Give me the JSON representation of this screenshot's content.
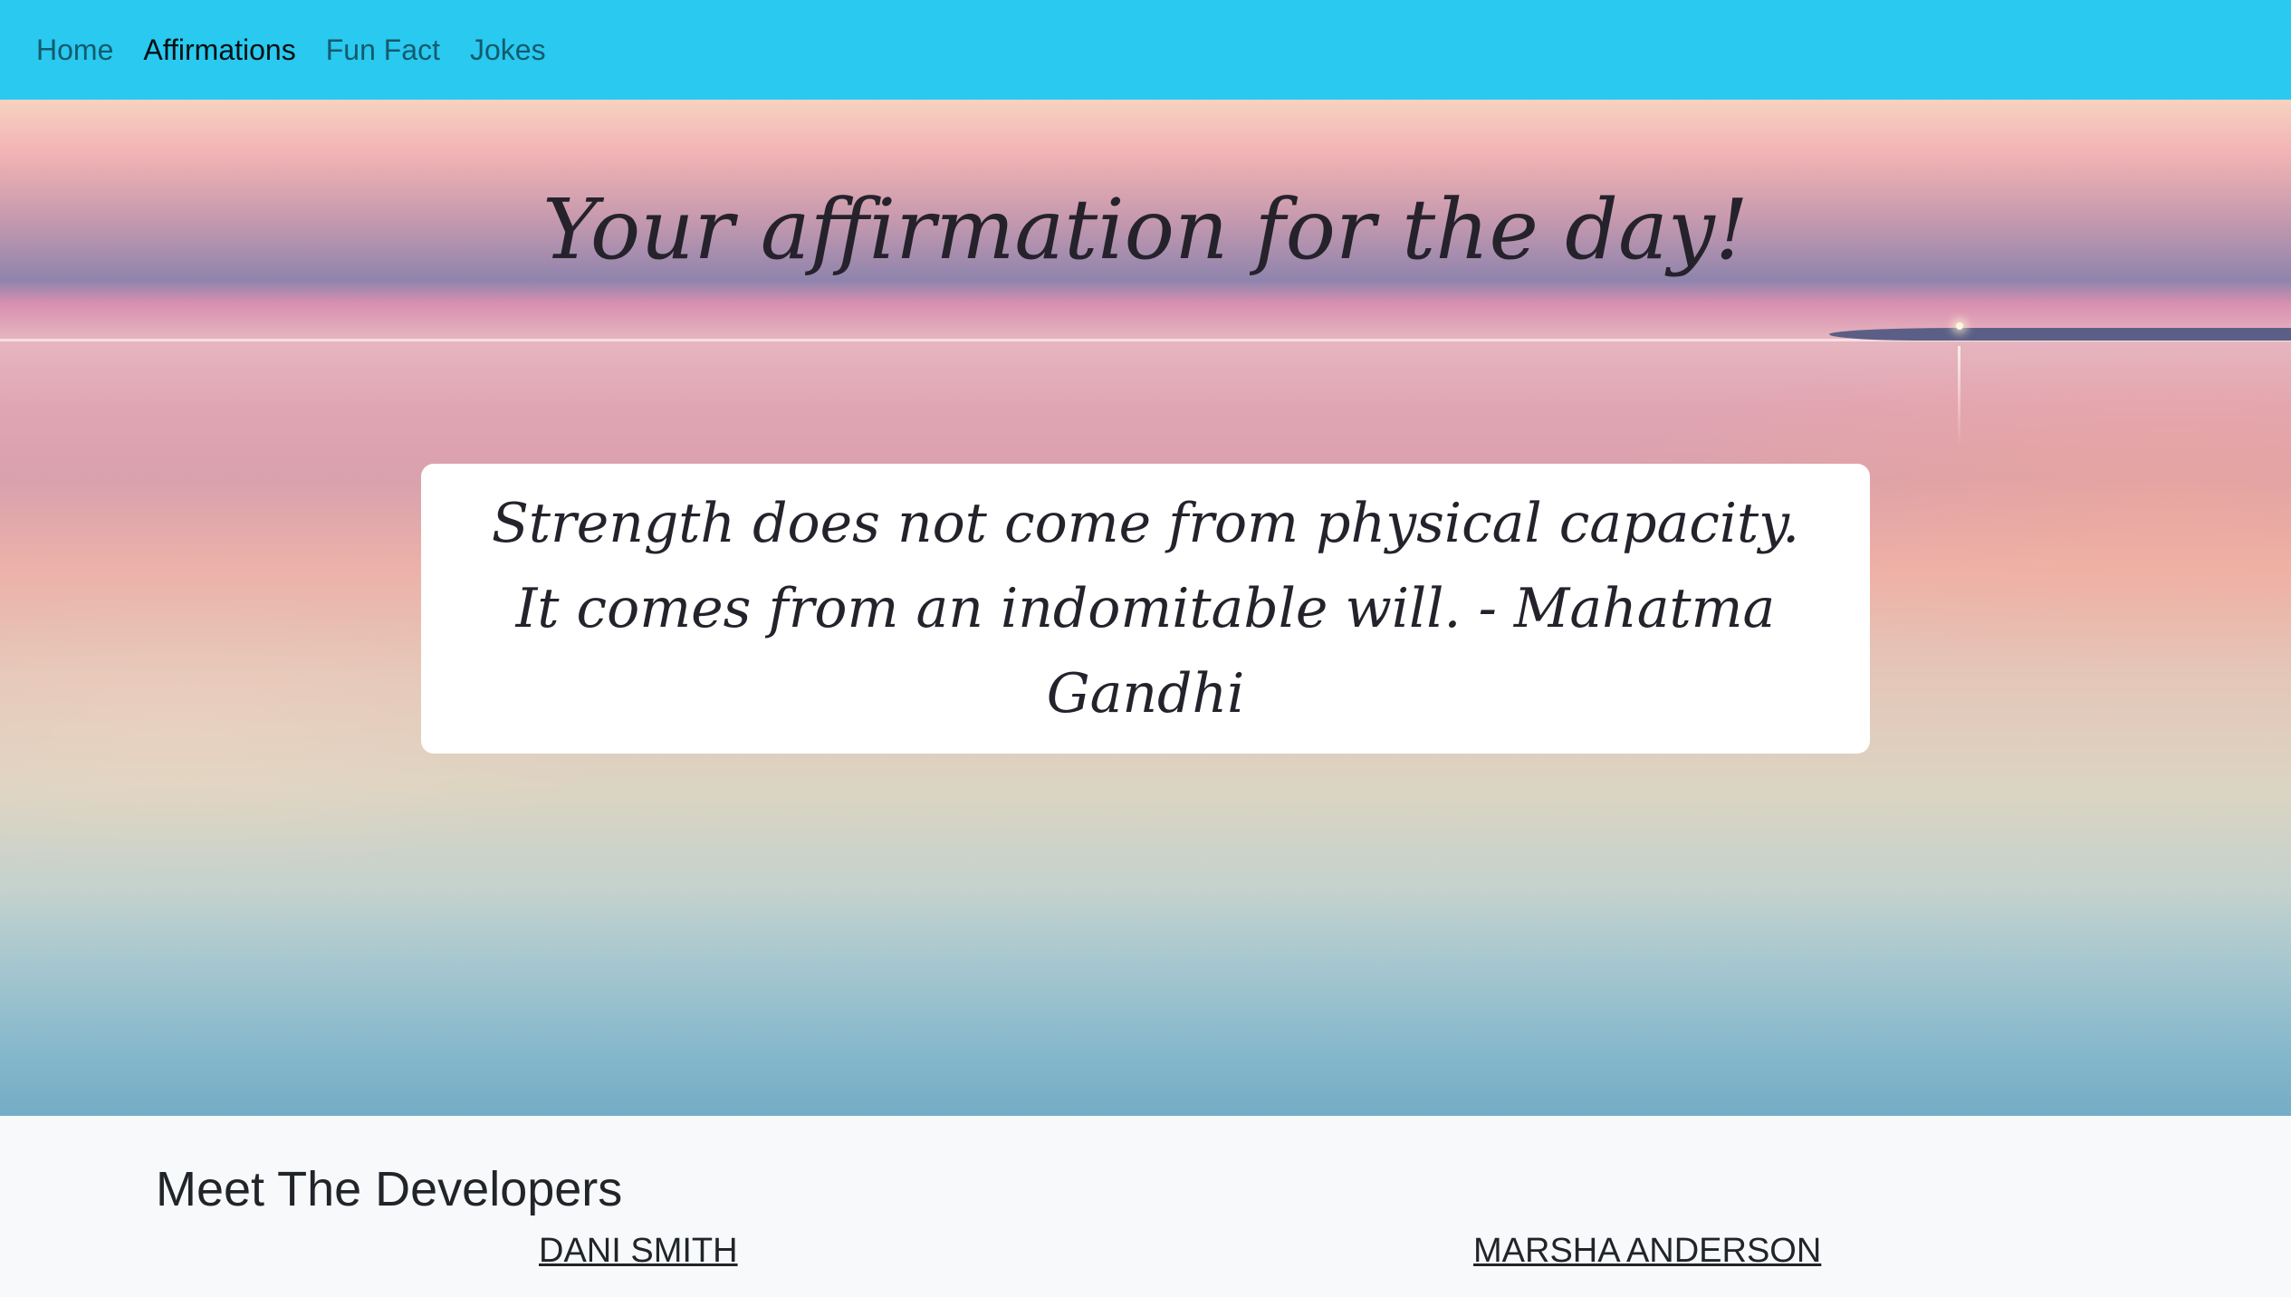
{
  "nav": {
    "items": [
      {
        "label": "Home",
        "active": false
      },
      {
        "label": "Affirmations",
        "active": true
      },
      {
        "label": "Fun Fact",
        "active": false
      },
      {
        "label": "Jokes",
        "active": false
      }
    ],
    "bar_color": "#29c9f0"
  },
  "hero": {
    "title": "Your affirmation for the day!",
    "quote": "Strength does not come from physical capacity. It comes from an indomitable will. - Mahatma Gandhi"
  },
  "developers": {
    "heading": "Meet The Developers",
    "names": [
      "DANI SMITH",
      "MARSHA ANDERSON"
    ]
  }
}
